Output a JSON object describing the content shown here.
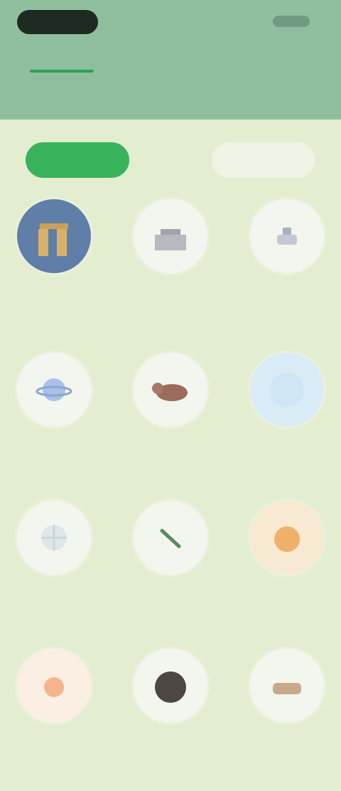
{
  "status_bar": {
    "time": "",
    "right": ""
  },
  "header": {
    "tabs": [
      {
        "label": ""
      },
      {
        "label": ""
      }
    ],
    "subtitle": ""
  },
  "actions": {
    "primary_label": "",
    "secondary_label": ""
  },
  "grid": {
    "items": [
      {
        "label": "",
        "icon": "temple-icon"
      },
      {
        "label": "",
        "icon": "building-icon"
      },
      {
        "label": "",
        "icon": "ship-icon"
      },
      {
        "label": "",
        "icon": "planet-icon"
      },
      {
        "label": "",
        "icon": "animal-icon"
      },
      {
        "label": "",
        "icon": "bubble-icon"
      },
      {
        "label": "",
        "icon": "globe-icon"
      },
      {
        "label": "",
        "icon": "leaf-icon"
      },
      {
        "label": "",
        "icon": "fruit-icon"
      },
      {
        "label": "",
        "icon": "food-icon"
      },
      {
        "label": "",
        "icon": "hat-icon"
      },
      {
        "label": "",
        "icon": "bread-icon"
      }
    ]
  },
  "colors": {
    "header_bg": "#8fbf9e",
    "page_bg": "#e3edcf",
    "primary": "#39b25c"
  }
}
